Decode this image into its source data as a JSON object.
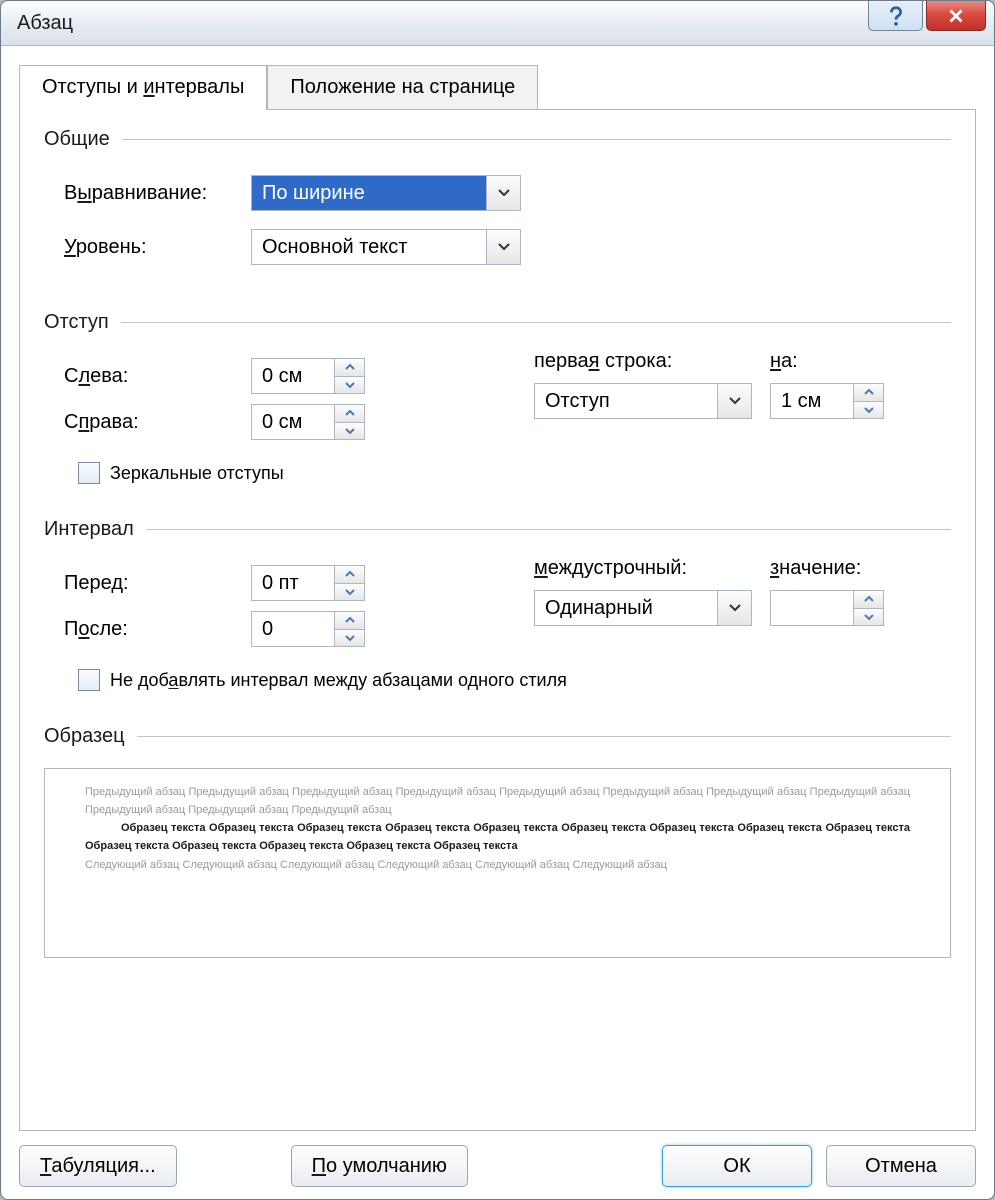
{
  "window": {
    "title": "Абзац"
  },
  "tabs": {
    "indents": "Отступы и интервалы",
    "position": "Положение на странице"
  },
  "general": {
    "title": "Общие",
    "align_label": "Выравнивание:",
    "align_value": "По ширине",
    "level_label": "Уровень:",
    "level_value": "Основной текст"
  },
  "indent": {
    "title": "Отступ",
    "left_label": "Слева:",
    "left_value": "0 см",
    "right_label": "Справа:",
    "right_value": "0 см",
    "first_line_label": "первая строка:",
    "by_label": "на:",
    "first_line_value": "Отступ",
    "by_value": "1 см",
    "mirror_label": "Зеркальные отступы"
  },
  "spacing": {
    "title": "Интервал",
    "before_label": "Перед:",
    "before_value": "0 пт",
    "after_label": "После:",
    "after_value": "0",
    "line_label": "междустрочный:",
    "at_label": "значение:",
    "line_value": "Одинарный",
    "at_value": "",
    "dont_add_label": "Не добавлять интервал между абзацами одного стиля"
  },
  "preview": {
    "title": "Образец",
    "prev_line": "Предыдущий абзац Предыдущий абзац Предыдущий абзац Предыдущий абзац Предыдущий абзац Предыдущий абзац Предыдущий абзац Предыдущий абзац Предыдущий абзац Предыдущий абзац Предыдущий абзац",
    "sample": "Образец текста Образец текста Образец текста Образец текста Образец текста Образец текста Образец текста Образец текста Образец текста Образец текста Образец текста Образец текста Образец текста Образец текста",
    "next_line": "Следующий абзац Следующий абзац Следующий абзац Следующий абзац Следующий абзац Следующий абзац"
  },
  "footer": {
    "tabs": "Табуляция...",
    "default": "По умолчанию",
    "ok": "ОК",
    "cancel": "Отмена"
  }
}
